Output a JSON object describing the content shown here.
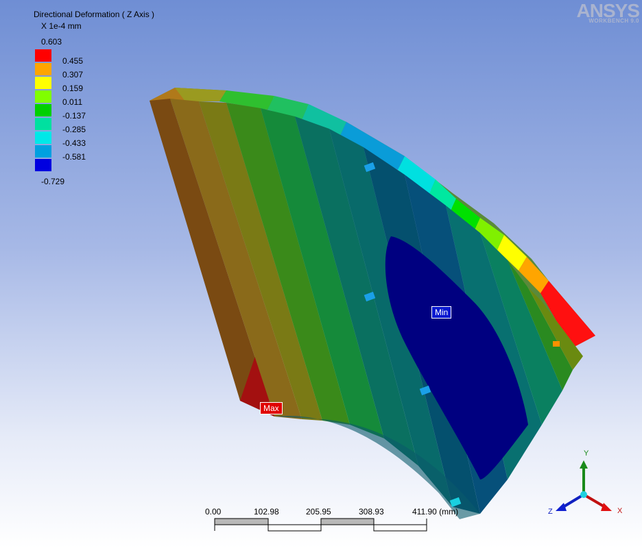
{
  "legend": {
    "title": "Directional Deformation ( Z Axis )",
    "units": "X 1e-4 mm",
    "max_label": "0.603",
    "min_label": "-0.729",
    "bands": [
      {
        "label": "0.455",
        "color": "#ff0000"
      },
      {
        "label": "0.307",
        "color": "#ffa500"
      },
      {
        "label": "0.159",
        "color": "#ffff00"
      },
      {
        "label": "0.011",
        "color": "#80ff00"
      },
      {
        "label": "-0.137",
        "color": "#00d000"
      },
      {
        "label": "-0.285",
        "color": "#00e0a0"
      },
      {
        "label": "-0.433",
        "color": "#00e8e8"
      },
      {
        "label": "-0.581",
        "color": "#00a0e0"
      },
      {
        "label": "",
        "color": "#0000e0"
      }
    ]
  },
  "logo": {
    "brand": "ANSYS",
    "product": "WORKBENCH 9.0"
  },
  "probes": {
    "max_label": "Max",
    "min_label": "Min"
  },
  "scale_bar": {
    "ticks": [
      "0.00",
      "102.98",
      "205.95",
      "308.93",
      "411.90 (mm)"
    ]
  },
  "triad": {
    "x_label": "X",
    "y_label": "Y",
    "z_label": "Z"
  },
  "colors": {
    "max_tag": "#e00000",
    "min_tag": "#0a19d0"
  }
}
